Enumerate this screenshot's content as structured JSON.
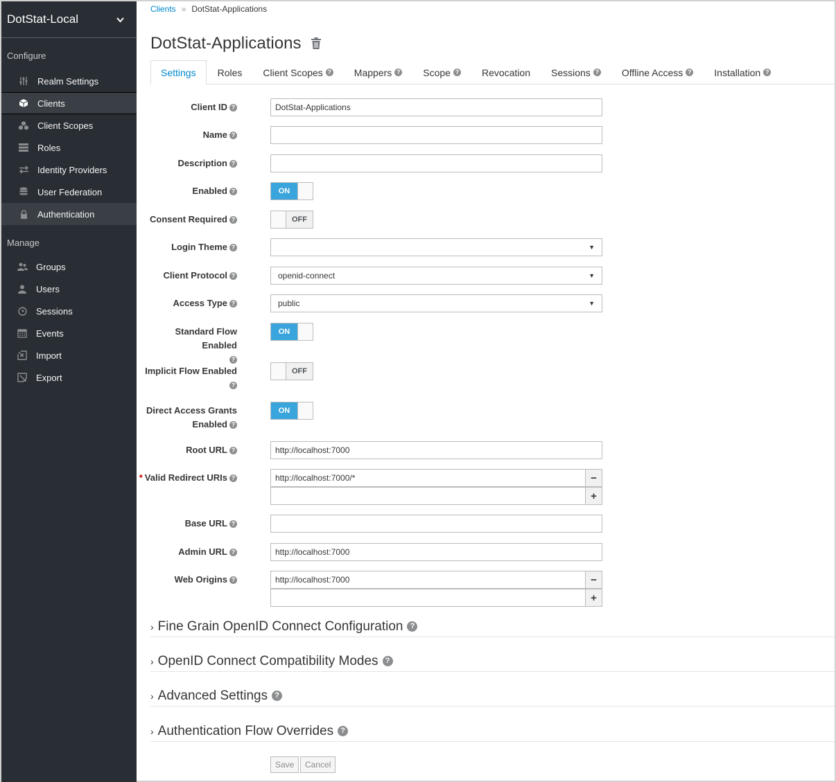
{
  "sidebar": {
    "realm": "DotStat-Local",
    "configure_title": "Configure",
    "configure_items": [
      {
        "label": "Realm Settings",
        "icon": "sliders-icon"
      },
      {
        "label": "Clients",
        "icon": "cube-icon"
      },
      {
        "label": "Client Scopes",
        "icon": "cubes-icon"
      },
      {
        "label": "Roles",
        "icon": "list-icon"
      },
      {
        "label": "Identity Providers",
        "icon": "exchange-icon"
      },
      {
        "label": "User Federation",
        "icon": "database-icon"
      },
      {
        "label": "Authentication",
        "icon": "lock-icon"
      }
    ],
    "manage_title": "Manage",
    "manage_items": [
      {
        "label": "Groups",
        "icon": "users-icon"
      },
      {
        "label": "Users",
        "icon": "user-icon"
      },
      {
        "label": "Sessions",
        "icon": "clock-icon"
      },
      {
        "label": "Events",
        "icon": "calendar-icon"
      },
      {
        "label": "Import",
        "icon": "import-icon"
      },
      {
        "label": "Export",
        "icon": "export-icon"
      }
    ]
  },
  "breadcrumb": {
    "root": "Clients",
    "separator": "»",
    "current": "DotStat-Applications"
  },
  "title": "DotStat-Applications",
  "tabs": [
    {
      "label": "Settings",
      "help": false,
      "active": true
    },
    {
      "label": "Roles",
      "help": false
    },
    {
      "label": "Client Scopes",
      "help": true
    },
    {
      "label": "Mappers",
      "help": true
    },
    {
      "label": "Scope",
      "help": true
    },
    {
      "label": "Revocation",
      "help": false
    },
    {
      "label": "Sessions",
      "help": true
    },
    {
      "label": "Offline Access",
      "help": true
    },
    {
      "label": "Installation",
      "help": true
    }
  ],
  "form": {
    "client_id": {
      "label": "Client ID",
      "value": "DotStat-Applications"
    },
    "name": {
      "label": "Name",
      "value": ""
    },
    "description": {
      "label": "Description",
      "value": ""
    },
    "enabled": {
      "label": "Enabled",
      "state": "ON"
    },
    "consent_required": {
      "label": "Consent Required",
      "state": "OFF"
    },
    "login_theme": {
      "label": "Login Theme",
      "value": ""
    },
    "client_protocol": {
      "label": "Client Protocol",
      "value": "openid-connect"
    },
    "access_type": {
      "label": "Access Type",
      "value": "public"
    },
    "standard_flow": {
      "label": "Standard Flow Enabled",
      "state": "ON"
    },
    "implicit_flow": {
      "label": "Implicit Flow Enabled",
      "state": "OFF"
    },
    "direct_access": {
      "label_line1": "Direct Access Grants",
      "label_line2": "Enabled",
      "state": "ON"
    },
    "root_url": {
      "label": "Root URL",
      "value": "http://localhost:7000"
    },
    "valid_redirect": {
      "required_mark": "*",
      "label": "Valid Redirect URIs",
      "values": [
        "http://localhost:7000/*",
        ""
      ]
    },
    "base_url": {
      "label": "Base URL",
      "value": ""
    },
    "admin_url": {
      "label": "Admin URL",
      "value": "http://localhost:7000"
    },
    "web_origins": {
      "label": "Web Origins",
      "values": [
        "http://localhost:7000",
        ""
      ]
    }
  },
  "sections": [
    "Fine Grain OpenID Connect Configuration",
    "OpenID Connect Compatibility Modes",
    "Advanced Settings",
    "Authentication Flow Overrides"
  ],
  "buttons": {
    "save": "Save",
    "cancel": "Cancel"
  },
  "colors": {
    "sidebar_bg": "#292e34",
    "accent": "#0088ce",
    "toggle_on": "#39a5dc"
  }
}
